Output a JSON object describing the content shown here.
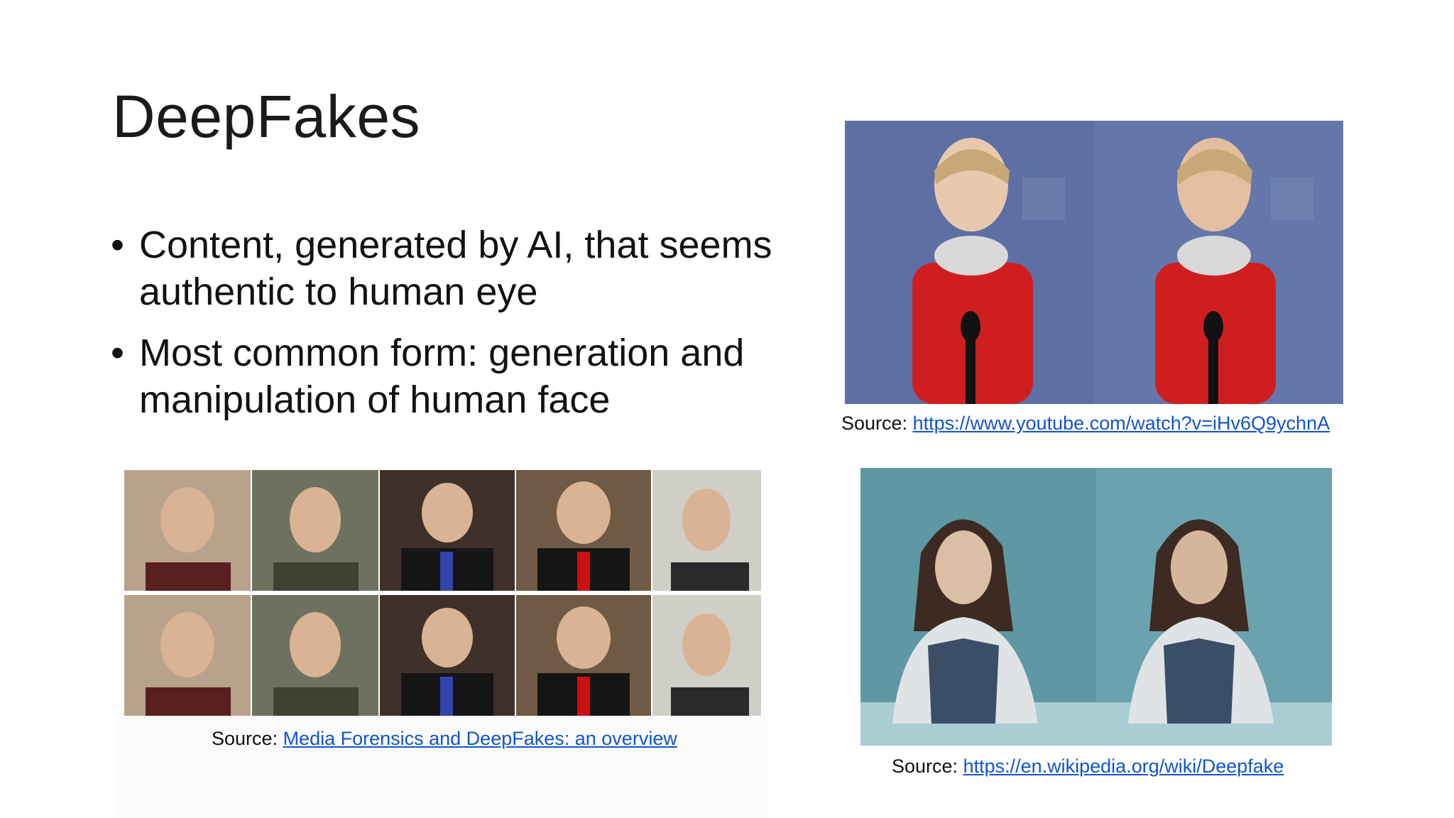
{
  "slide": {
    "title": "DeepFakes",
    "bullets": [
      {
        "text": "Content, generated by AI, that seems authentic to human eye"
      },
      {
        "text": "Most common form: generation and manipulation of human face"
      }
    ],
    "bullet_glyph": "•"
  },
  "images": {
    "top_right": {
      "caption_prefix": "Source: ",
      "caption_link": "https://www.youtube.com/watch?v=iHv6Q9ychnA"
    },
    "bottom_left": {
      "caption_prefix": "Source: ",
      "caption_link": "Media Forensics and DeepFakes: an overview"
    },
    "bottom_right": {
      "caption_prefix": "Source: ",
      "caption_link": "https://en.wikipedia.org/wiki/Deepfake"
    }
  },
  "colors": {
    "link": "#1155cc",
    "stage_blue": "#5d6fa3",
    "dress_red": "#d01e20",
    "teal_scene": "#6aa3ad"
  }
}
